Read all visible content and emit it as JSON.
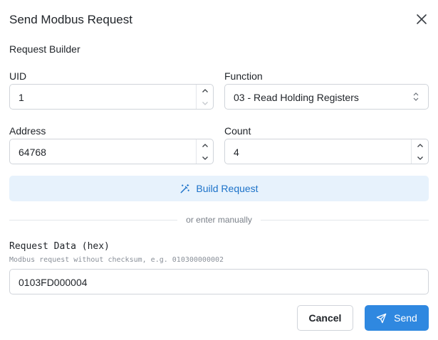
{
  "dialog": {
    "title": "Send Modbus Request",
    "close_icon": "close-icon"
  },
  "builder": {
    "section_title": "Request Builder",
    "uid": {
      "label": "UID",
      "value": "1"
    },
    "function": {
      "label": "Function",
      "selected": "03 - Read Holding Registers"
    },
    "address": {
      "label": "Address",
      "value": "64768"
    },
    "count": {
      "label": "Count",
      "value": "4"
    },
    "build_button": {
      "label": "Build Request",
      "icon": "magic-wand-icon"
    }
  },
  "divider": {
    "text": "or enter manually"
  },
  "manual": {
    "label": "Request Data (hex)",
    "hint": "Modbus request without checksum, e.g. 010300000002",
    "value": "0103FD000004"
  },
  "actions": {
    "cancel_label": "Cancel",
    "send_label": "Send",
    "send_icon": "send-icon"
  },
  "colors": {
    "accent": "#2f88e0",
    "build_bg": "#e7f2fc",
    "build_text": "#1c72c9"
  }
}
